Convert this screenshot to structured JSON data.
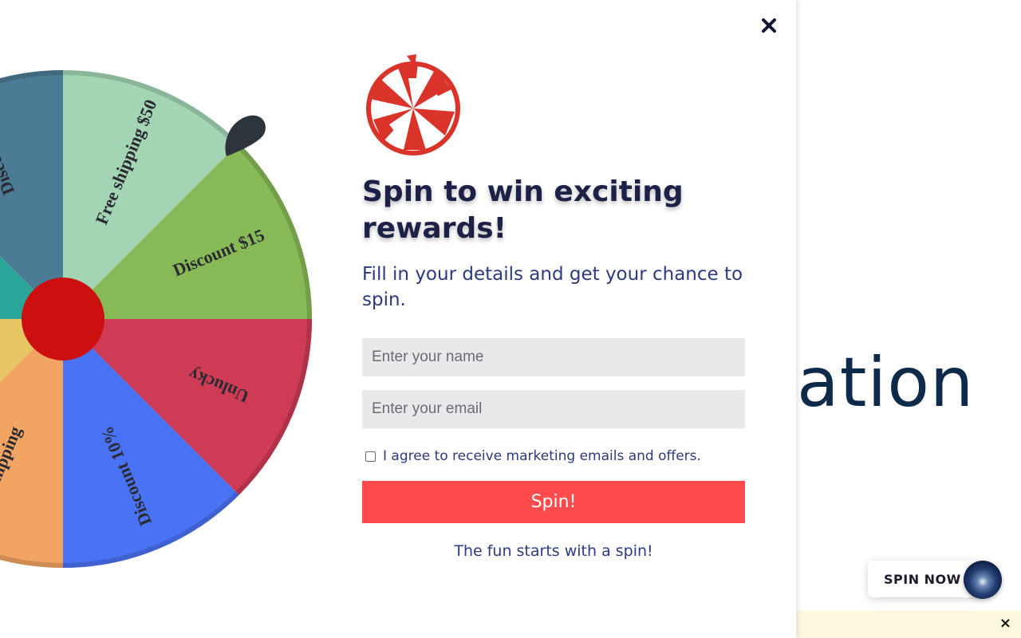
{
  "background": {
    "heading_fragment": "ation",
    "spin_now_label": "SPIN NOW",
    "bar_close": "×"
  },
  "modal": {
    "close_label": "×",
    "headline": "Spin to win exciting rewards!",
    "subtext": "Fill in your details and get your chance to spin.",
    "name_placeholder": "Enter your name",
    "email_placeholder": "Enter your email",
    "consent_label": "I agree to receive marketing emails and offers.",
    "consent_checked": false,
    "spin_button": "Spin!",
    "footer": "The fun starts with a spin!"
  },
  "wheel": {
    "segments": [
      {
        "label": "Free shipping $50",
        "color": "#a3d5b4"
      },
      {
        "label": "Discount $15",
        "color": "#88b957"
      },
      {
        "label": "Unlucky",
        "color": "#cf3b55"
      },
      {
        "label": "Discount 10%",
        "color": "#4a72f5"
      },
      {
        "label": "Free shipping",
        "color": "#f2a563"
      },
      {
        "label": "",
        "color": "#e8c664"
      },
      {
        "label": "",
        "color": "#2aa59a"
      },
      {
        "label": "Discount",
        "color": "#4b7b95"
      }
    ],
    "hub_color": "#cc0f0f",
    "pointer_color": "#2e343c"
  },
  "colors": {
    "accent": "#ff4b4b",
    "headline": "#1e2147",
    "body_text": "#2c3a7e"
  }
}
